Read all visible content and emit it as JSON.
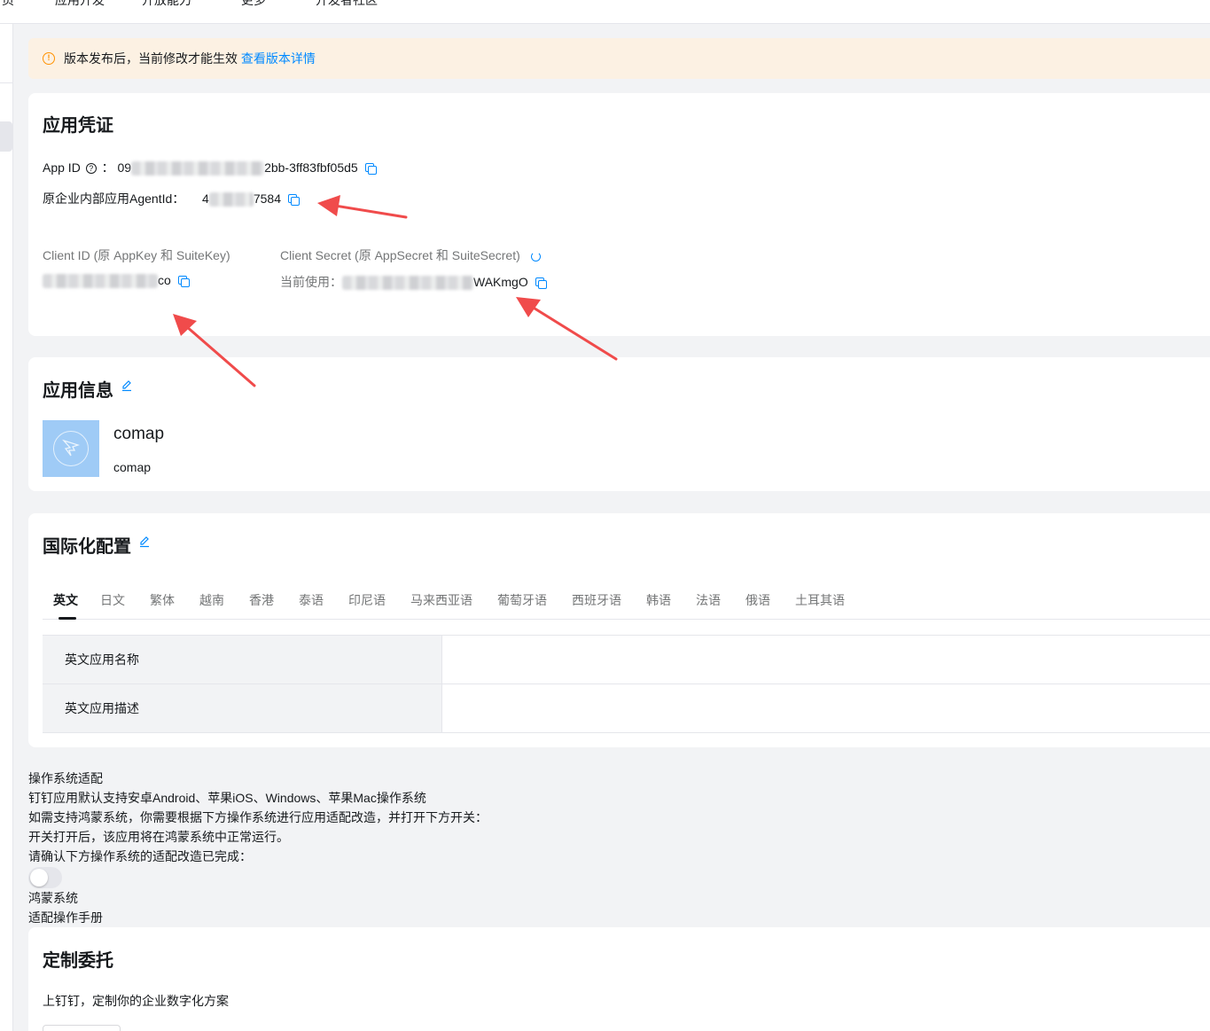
{
  "topnav": [
    "首页",
    "应用开发",
    "开放能力",
    "更多",
    "开发者社区"
  ],
  "notice": {
    "text": "版本发布后，当前修改才能生效",
    "link": "查看版本详情"
  },
  "credentials": {
    "title": "应用凭证",
    "app_id_label": "App ID",
    "app_id_prefix": "09",
    "app_id_suffix": "2bb-3ff83fbf05d5",
    "agent_label": "原企业内部应用AgentId：",
    "agent_prefix": "4",
    "agent_suffix": "7584",
    "client_id_label": "Client ID (原 AppKey 和 SuiteKey)",
    "client_id_suffix": "co",
    "client_secret_label": "Client Secret (原 AppSecret 和 SuiteSecret)",
    "current_use_label": "当前使用：",
    "client_secret_suffix": "WAKmgO"
  },
  "app_info": {
    "title": "应用信息",
    "name": "comap",
    "description": "comap"
  },
  "i18n": {
    "title": "国际化配置",
    "tabs": [
      "英文",
      "日文",
      "繁体",
      "越南",
      "香港",
      "泰语",
      "印尼语",
      "马来西亚语",
      "葡萄牙语",
      "西班牙语",
      "韩语",
      "法语",
      "俄语",
      "土耳其语"
    ],
    "active_tab": "英文",
    "rows": [
      {
        "label": "英文应用名称",
        "value": ""
      },
      {
        "label": "英文应用描述",
        "value": ""
      }
    ]
  },
  "os_adapt": {
    "title": "操作系统适配",
    "line1": "钉钉应用默认支持安卓Android、苹果iOS、Windows、苹果Mac操作系统",
    "line2": "如需支持鸿蒙系统，你需要根据下方操作系统进行应用适配改造，并打开下方开关：",
    "line3": "开关打开后，该应用将在鸿蒙系统中正常运行。",
    "line4": "请确认下方操作系统的适配改造已完成：",
    "toggle_on": false,
    "toggle_label": "鸿蒙系统",
    "manual_link": "适配操作手册"
  },
  "custom": {
    "title": "定制委托",
    "description": "上钉钉，定制你的企业数字化方案"
  },
  "colors": {
    "accent": "#0089ff",
    "annotation_arrow": "#f04b4b",
    "notice_bg": "#fcf1e3",
    "warning": "#ff9200"
  }
}
